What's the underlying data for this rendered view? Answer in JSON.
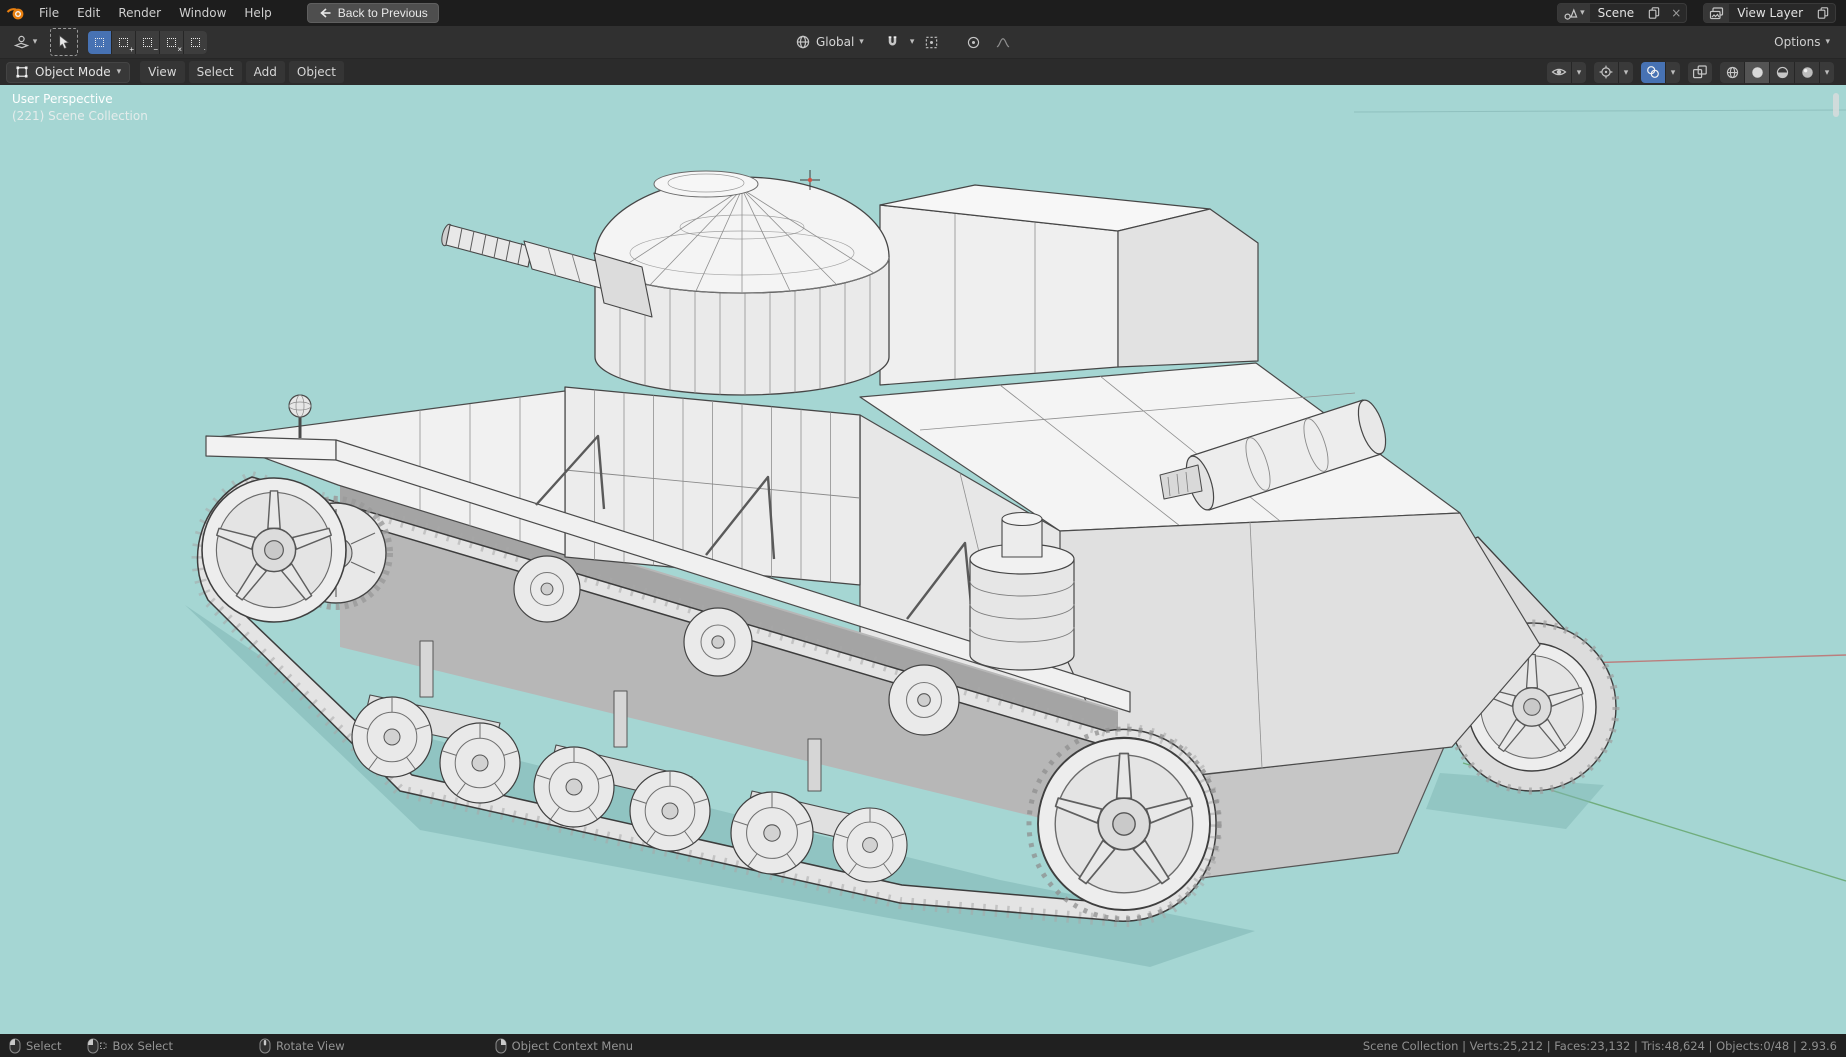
{
  "icons": {
    "chevron_down": "▾",
    "close": "×",
    "plus": "+",
    "minus": "−",
    "times": "×",
    "dot": "·"
  },
  "topbar": {
    "menus": [
      "File",
      "Edit",
      "Render",
      "Window",
      "Help"
    ],
    "back_label": "Back to Previous",
    "scene_label": "Scene",
    "view_layer_label": "View Layer"
  },
  "tool_settings": {
    "orientation_label": "Global",
    "options_label": "Options"
  },
  "viewport_header": {
    "mode_label": "Object Mode",
    "menus": [
      "View",
      "Select",
      "Add",
      "Object"
    ]
  },
  "viewport": {
    "overlay_line1": "User Perspective",
    "overlay_line2": "(221) Scene Collection"
  },
  "statusbar": {
    "hints": [
      {
        "label": "Select"
      },
      {
        "label": "Box Select"
      },
      {
        "label": "Rotate View"
      },
      {
        "label": "Object Context Menu"
      }
    ],
    "stats": "Scene Collection | Verts:25,212 | Faces:23,132 | Tris:48,624 | Objects:0/48 | 2.93.6"
  },
  "colors": {
    "accent": "#4772b3",
    "viewport-bg": "#a5d6d3",
    "topbar-bg": "#1d1d1d",
    "toolbar-bg": "#303030",
    "header-bg": "#2b2b2b",
    "status-bg": "#202020"
  }
}
